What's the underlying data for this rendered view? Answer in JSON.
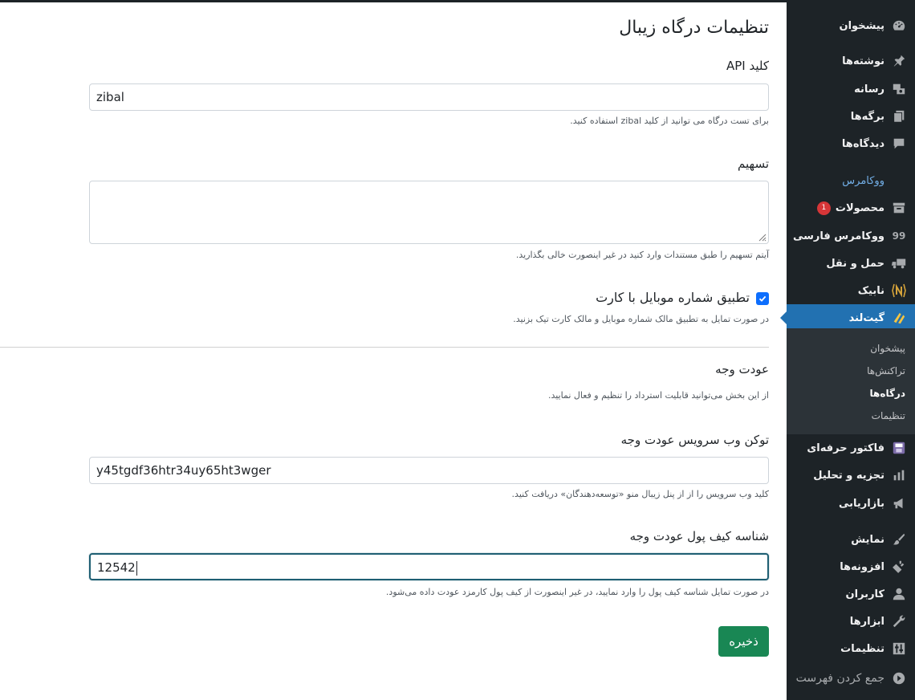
{
  "page": {
    "title": "تنظیمات درگاه زیبال"
  },
  "form": {
    "api_key": {
      "label": "کلید API",
      "value": "zibal",
      "help": "برای تست درگاه می توانید از کلید zibal استفاده کنید."
    },
    "share": {
      "label": "تسهیم",
      "value": "",
      "help": "آیتم تسهیم را طبق مستندات وارد کنید در غیر اینصورت خالی بگذارید."
    },
    "mobile_match": {
      "label": "تطبیق شماره موبایل با کارت",
      "checked": true,
      "help": "در صورت تمایل به تطبیق مالک شماره موبایل و مالک کارت تیک بزنید."
    },
    "refund_section": {
      "heading": "عودت وجه",
      "help": "از این بخش می‌توانید قابلیت استرداد را تنظیم و فعال نمایید."
    },
    "refund_token": {
      "label": "توکن وب سرویس عودت وجه",
      "value": "y45tgdf36htr34uy65ht3wger",
      "help": "کلید وب سرویس را از از پنل زیبال منو «توسعه‌دهندگان» دریافت کنید."
    },
    "refund_wallet": {
      "label": "شناسه کیف پول عودت وجه",
      "value": "12542",
      "help": "در صورت تمایل شناسه کیف پول را وارد نمایید، در غیر اینصورت از کیف پول کارمزد عودت داده می‌شود."
    },
    "save_label": "ذخیره"
  },
  "sidebar": {
    "items": [
      {
        "label": "پیشخوان",
        "icon": "dashboard-icon"
      },
      {
        "label": "نوشته‌ها",
        "icon": "pin-icon"
      },
      {
        "label": "رسانه",
        "icon": "media-icon"
      },
      {
        "label": "برگه‌ها",
        "icon": "pages-icon"
      },
      {
        "label": "دیدگاه‌ها",
        "icon": "comments-icon"
      },
      {
        "label": "ووکامرس",
        "icon": ""
      },
      {
        "label": "محصولات",
        "icon": "archive-icon",
        "badge": "1"
      },
      {
        "label": "ووکامرس فارسی",
        "icon": "quote-icon"
      },
      {
        "label": "حمل و نقل",
        "icon": "truck-icon"
      },
      {
        "label": "نابیک",
        "icon": "nabik-logo-icon"
      },
      {
        "label": "گیت‌لند",
        "icon": "gateland-logo-icon"
      },
      {
        "label": "فاکتور حرفه‌ای",
        "icon": "invoice-icon"
      },
      {
        "label": "تجزیه و تحلیل",
        "icon": "chart-bar-icon"
      },
      {
        "label": "بازاریابی",
        "icon": "megaphone-icon"
      },
      {
        "label": "نمایش",
        "icon": "brush-icon"
      },
      {
        "label": "افزونه‌ها",
        "icon": "plugin-icon"
      },
      {
        "label": "کاربران",
        "icon": "user-icon"
      },
      {
        "label": "ابزارها",
        "icon": "wrench-icon"
      },
      {
        "label": "تنظیمات",
        "icon": "settings-icon"
      },
      {
        "label": "جمع کردن فهرست",
        "icon": "collapse-icon"
      }
    ],
    "submenu": [
      {
        "label": "پیشخوان"
      },
      {
        "label": "تراکنش‌ها"
      },
      {
        "label": "درگاه‌ها"
      },
      {
        "label": "تنظیمات"
      }
    ],
    "colors": {
      "background": "#1d2327",
      "active": "#2271b1",
      "submenu": "#2c3338",
      "badge": "#d63638"
    }
  },
  "colors": {
    "save_button": "#198754",
    "checkbox": "#0d6efd",
    "focus_border": "#1f5f73"
  }
}
